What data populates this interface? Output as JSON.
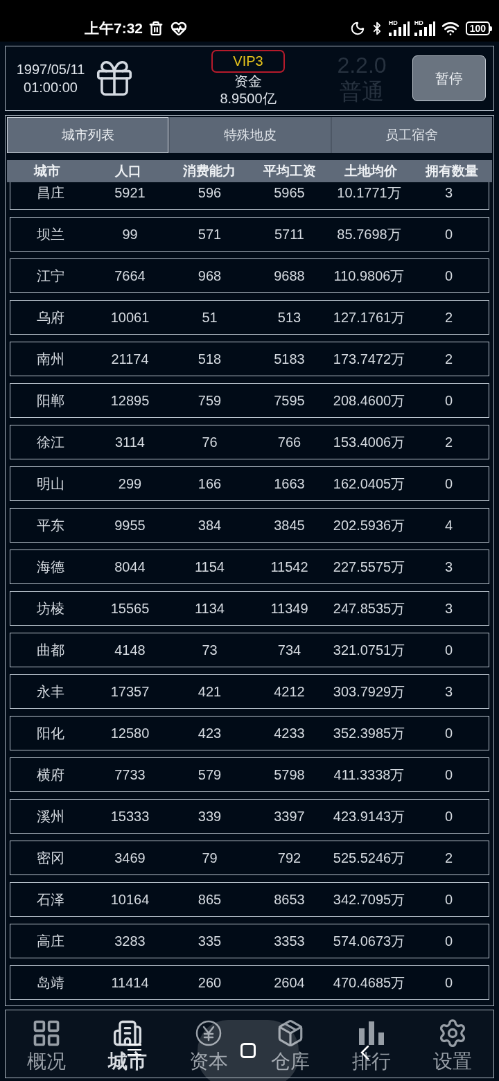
{
  "status_bar": {
    "time": "上午7:32",
    "signals": [
      {
        "label": "HD"
      },
      {
        "label": "HD"
      }
    ],
    "battery": "100"
  },
  "header": {
    "date": "1997/05/11",
    "time": "01:00:00",
    "vip": "VIP3",
    "funds_label": "资金",
    "funds_value": "8.9500亿",
    "version": "2.2.0",
    "mode": "普通",
    "pause_button": "暂停"
  },
  "tabs": [
    {
      "label": "城市列表",
      "selected": true
    },
    {
      "label": "特殊地皮",
      "selected": false
    },
    {
      "label": "员工宿舍",
      "selected": false
    }
  ],
  "table": {
    "columns": [
      "城市",
      "人口",
      "消费能力",
      "平均工资",
      "土地均价",
      "拥有数量"
    ],
    "rows": [
      [
        "昌庄",
        "5921",
        "596",
        "5965",
        "10.1771万",
        "3"
      ],
      [
        "坝兰",
        "99",
        "571",
        "5711",
        "85.7698万",
        "0"
      ],
      [
        "江宁",
        "7664",
        "968",
        "9688",
        "110.9806万",
        "0"
      ],
      [
        "乌府",
        "10061",
        "51",
        "513",
        "127.1761万",
        "2"
      ],
      [
        "南州",
        "21174",
        "518",
        "5183",
        "173.7472万",
        "2"
      ],
      [
        "阳郸",
        "12895",
        "759",
        "7595",
        "208.4600万",
        "0"
      ],
      [
        "徐江",
        "3114",
        "76",
        "766",
        "153.4006万",
        "2"
      ],
      [
        "明山",
        "299",
        "166",
        "1663",
        "162.0405万",
        "0"
      ],
      [
        "平东",
        "9955",
        "384",
        "3845",
        "202.5936万",
        "4"
      ],
      [
        "海德",
        "8044",
        "1154",
        "11542",
        "227.5575万",
        "3"
      ],
      [
        "坊棱",
        "15565",
        "1134",
        "11349",
        "247.8535万",
        "3"
      ],
      [
        "曲都",
        "4148",
        "73",
        "734",
        "321.0751万",
        "0"
      ],
      [
        "永丰",
        "17357",
        "421",
        "4212",
        "303.7929万",
        "3"
      ],
      [
        "阳化",
        "12580",
        "423",
        "4233",
        "352.3985万",
        "0"
      ],
      [
        "横府",
        "7733",
        "579",
        "5798",
        "411.3338万",
        "0"
      ],
      [
        "溪州",
        "15333",
        "339",
        "3397",
        "423.9143万",
        "0"
      ],
      [
        "密冈",
        "3469",
        "79",
        "792",
        "525.5246万",
        "2"
      ],
      [
        "石泽",
        "10164",
        "865",
        "8653",
        "342.7095万",
        "0"
      ],
      [
        "高庄",
        "3283",
        "335",
        "3353",
        "574.0673万",
        "0"
      ],
      [
        "岛靖",
        "11414",
        "260",
        "2604",
        "470.4685万",
        "0"
      ]
    ]
  },
  "bottom_nav": [
    {
      "label": "概况",
      "selected": false
    },
    {
      "label": "城市",
      "selected": true
    },
    {
      "label": "资本",
      "selected": false
    },
    {
      "label": "仓库",
      "selected": false
    },
    {
      "label": "排行",
      "selected": false
    },
    {
      "label": "设置",
      "selected": false
    }
  ]
}
